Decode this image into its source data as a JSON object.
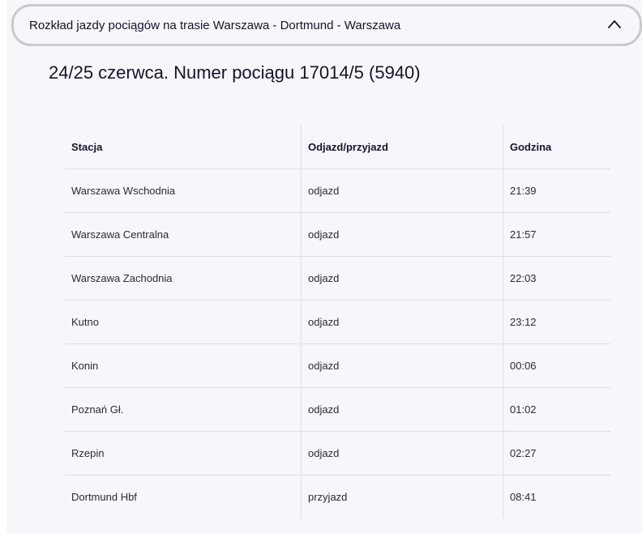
{
  "accordion": {
    "title": "Rozkład jazdy pociągów na trasie Warszawa - Dortmund - Warszawa",
    "icon": "chevron-up-icon"
  },
  "section": {
    "title": "24/25 czerwca. Numer pociągu 17014/5 (5940)"
  },
  "table": {
    "headers": [
      "Stacja",
      "Odjazd/przyjazd",
      "Godzina"
    ],
    "rows": [
      [
        "Warszawa Wschodnia",
        "odjazd",
        "21:39"
      ],
      [
        "Warszawa Centralna",
        "odjazd",
        "21:57"
      ],
      [
        "Warszawa Zachodnia",
        "odjazd",
        "22:03"
      ],
      [
        "Kutno",
        "odjazd",
        "23:12"
      ],
      [
        "Konin",
        "odjazd",
        "00:06"
      ],
      [
        "Poznań Gł.",
        "odjazd",
        "01:02"
      ],
      [
        "Rzepin",
        "odjazd",
        "02:27"
      ],
      [
        "Dortmund Hbf",
        "przyjazd",
        "08:41"
      ]
    ]
  }
}
